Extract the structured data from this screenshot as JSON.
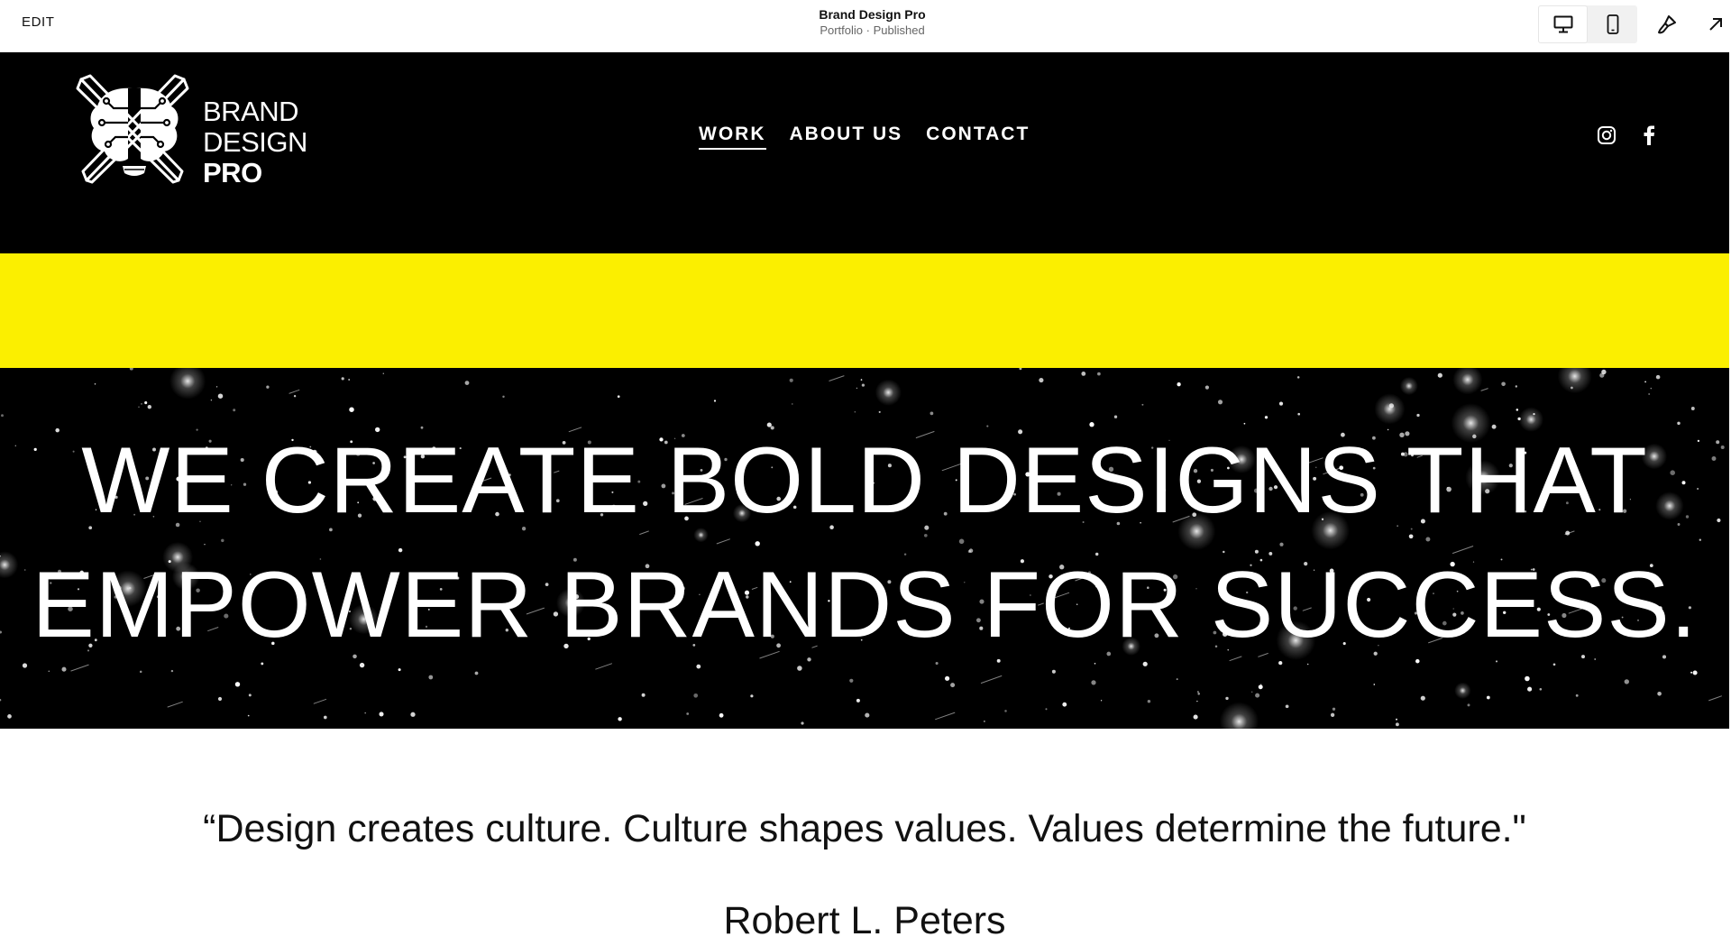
{
  "editor": {
    "edit_label": "EDIT",
    "site_title": "Brand Design Pro",
    "site_status": "Portfolio · Published",
    "icons": [
      "desktop-icon",
      "mobile-icon",
      "paintbrush-icon",
      "open-external-icon"
    ]
  },
  "header": {
    "logo": {
      "line1": "BRAND",
      "line2": "DESIGN",
      "line3": "PRO",
      "icon": "brain-pencil-logo"
    },
    "nav": [
      {
        "label": "WORK",
        "active": true
      },
      {
        "label": "ABOUT US",
        "active": false
      },
      {
        "label": "CONTACT",
        "active": false
      }
    ],
    "social_icons": [
      "instagram-icon",
      "facebook-icon"
    ]
  },
  "colors": {
    "header_bg": "#000000",
    "accent_band": "#fbef00",
    "hero_bg": "#000000",
    "text_light": "#ffffff",
    "text_dark": "#111111"
  },
  "hero": {
    "line1": "WE CREATE BOLD DESIGNS THAT",
    "line2": "EMPOWER BRANDS FOR SUCCESS."
  },
  "quote": {
    "text": "“Design creates culture. Culture shapes values. Values determine the future.\"",
    "author": "Robert L. Peters"
  }
}
